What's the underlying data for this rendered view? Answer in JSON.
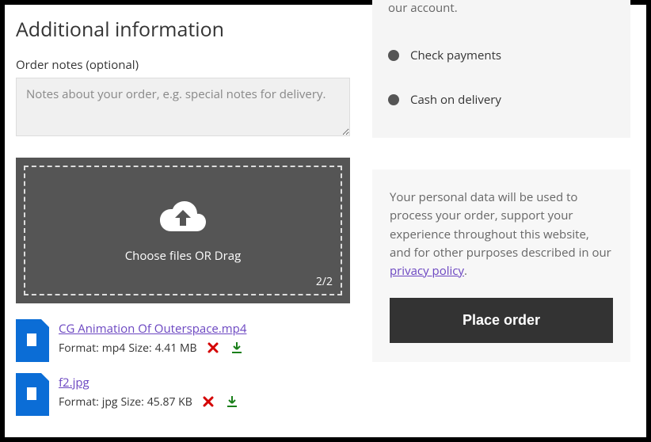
{
  "section_title": "Additional information",
  "notes": {
    "label": "Order notes (optional)",
    "placeholder": "Notes about your order, e.g. special notes for delivery."
  },
  "upload": {
    "prompt": "Choose files OR Drag",
    "count": "2/2"
  },
  "files": [
    {
      "name": "CG Animation Of Outerspace.mp4",
      "format": "mp4",
      "size": "4.41 MB"
    },
    {
      "name": "f2.jpg",
      "format": "jpg",
      "size": "45.87 KB"
    }
  ],
  "metaPrefixFormat": "Format: ",
  "metaPrefixSize": " Size: ",
  "payment": {
    "fragment": "our account.",
    "options": [
      {
        "label": "Check payments"
      },
      {
        "label": "Cash on delivery"
      }
    ]
  },
  "privacy": {
    "text": "Your personal data will be used to process your order, support your experience throughout this website, and for other purposes described in our ",
    "link_text": "privacy policy",
    "suffix": "."
  },
  "place_order": "Place order"
}
